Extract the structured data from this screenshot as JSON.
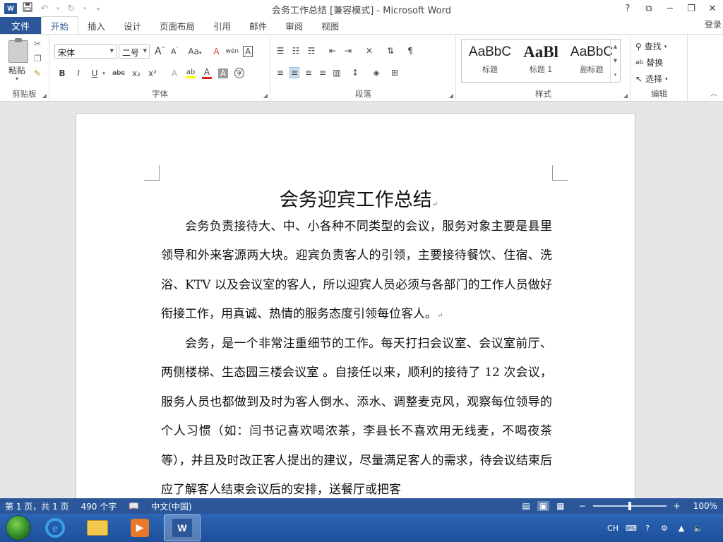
{
  "window": {
    "title": "会务工作总结 [兼容模式] - Microsoft Word",
    "logo_letter": "W",
    "controls": [
      "?",
      "⧉",
      "─",
      "❐",
      "✕"
    ],
    "login_label": "登录"
  },
  "qat": {
    "save_icon": "save-icon",
    "undo_icon": "undo-icon",
    "redo_icon": "redo-icon"
  },
  "ribbon": {
    "file_tab": "文件",
    "tabs": [
      "开始",
      "插入",
      "设计",
      "页面布局",
      "引用",
      "邮件",
      "审阅",
      "视图"
    ],
    "active_tab": "开始",
    "groups": {
      "clipboard": {
        "label": "剪贴板",
        "paste_label": "粘贴"
      },
      "font": {
        "label": "字体",
        "font_name": "宋体",
        "font_size": "二号",
        "grow_label": "A",
        "shrink_label": "A",
        "case_label": "Aa",
        "clear_label": "A",
        "phonetic_label": "wén",
        "border_label": "A",
        "bold": "B",
        "italic": "I",
        "underline": "U",
        "strike": "abc",
        "subscript": "x₂",
        "superscript": "x²",
        "effects_label": "A",
        "highlight_label": "ab",
        "color_label": "A",
        "shading_label": "A",
        "enclose_label": "字"
      },
      "paragraph": {
        "label": "段落"
      },
      "styles": {
        "label": "样式",
        "items": [
          {
            "sample": "AaBbC",
            "name": "标题"
          },
          {
            "sample": "AaBl",
            "name": "标题 1"
          },
          {
            "sample": "AaBbC",
            "name": "副标题"
          }
        ]
      },
      "editing": {
        "label": "编辑",
        "find": "查找",
        "replace": "替换",
        "select": "选择"
      }
    }
  },
  "document": {
    "title": "会务迎宾工作总结",
    "paragraphs": [
      "会务负责接待大、中、小各种不同类型的会议，服务对象主要是县里领导和外来客源两大块。迎宾负责客人的引领，主要接待餐饮、住宿、洗浴、KTV 以及会议室的客人，所以迎宾人员必须与各部门的工作人员做好衔接工作，用真诚、热情的服务态度引领每位客人。",
      "会务，是一个非常注重细节的工作。每天打扫会议室、会议室前厅、两侧楼梯、生态园三楼会议室 。自接任以来，顺利的接待了 12 次会议，服务人员也都做到及时为客人倒水、添水、调整麦克风，观察每位领导的个人习惯（如：闫书记喜欢喝浓茶，李县长不喜欢用无线麦，不喝夜茶等），并且及时改正客人提出的建议，尽量满足客人的需求，待会议结束后应了解客人结束会议后的安排，送餐厅或把客"
    ],
    "para_mark": "↵"
  },
  "status": {
    "page": "第 1 页，共 1 页",
    "words": "490 个字",
    "language": "中文(中国)",
    "zoom": "100%",
    "zoom_level": 1.0,
    "zoom_minus": "−",
    "zoom_plus": "+"
  },
  "taskbar": {
    "ie_letter": "e",
    "word_letter": "W",
    "tray": {
      "lang": "CH"
    }
  },
  "colors": {
    "accent": "#2b579a",
    "taskbar": "#1e4f9a"
  }
}
